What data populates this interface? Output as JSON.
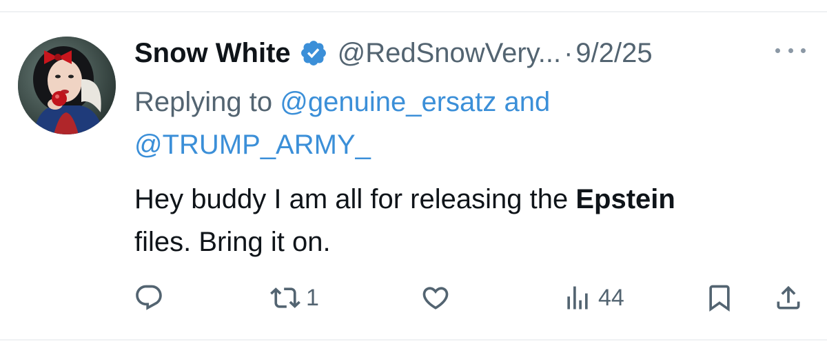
{
  "tweet": {
    "author": {
      "display_name": "Snow White",
      "handle": "@RedSnowVery...",
      "verified": true,
      "avatar_icon": "avatar-photo"
    },
    "separator": "·",
    "date": "9/2/25",
    "replying_prefix": "Replying to",
    "replying_users": [
      "@genuine_ersatz",
      "@TRUMP_ARMY_"
    ],
    "replying_conjunction": "and",
    "text_before": "Hey buddy I am all for releasing the",
    "text_bold": "Epstein",
    "text_after": "files. Bring it on."
  },
  "actions": {
    "reply": {
      "icon": "reply-icon",
      "count": ""
    },
    "retweet": {
      "icon": "retweet-icon",
      "count": "1"
    },
    "like": {
      "icon": "heart-icon",
      "count": ""
    },
    "views": {
      "icon": "views-icon",
      "count": "44"
    },
    "bookmark": {
      "icon": "bookmark-icon"
    },
    "share": {
      "icon": "share-icon"
    }
  },
  "colors": {
    "text": "#0f1419",
    "secondary": "#536471",
    "link": "#3b8fd8",
    "verified": "#3b8fd8",
    "divider": "#eff1f3"
  }
}
